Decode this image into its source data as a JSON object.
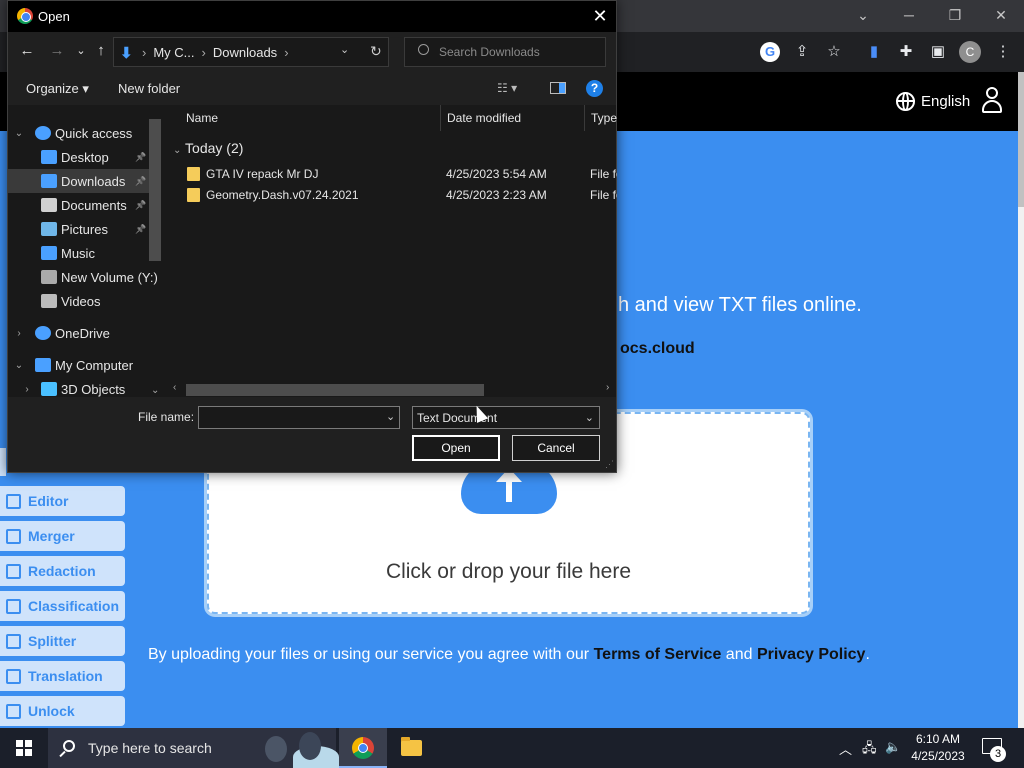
{
  "browser": {
    "window_controls": {
      "minimize": "─",
      "restore": "❐",
      "close": "✕",
      "tabs_menu": "⌄"
    },
    "toolbar_icons": [
      "google-icon",
      "share-icon",
      "bookmark-star-icon",
      "extension-docs-icon",
      "extensions-puzzle-icon",
      "side-panel-icon",
      "profile-avatar",
      "kebab-menu-icon"
    ],
    "profile_initial": "C"
  },
  "website": {
    "language": "English",
    "hero_headline": "h and view TXT files online.",
    "hero_domain": "ocs.cloud",
    "drop_text": "Click or drop your file here",
    "consent": {
      "prefix": "By uploading your files or using our service you agree with our ",
      "terms": "Terms of Service",
      "and": " and ",
      "privacy": "Privacy Policy",
      "suffix": "."
    },
    "tools": [
      "Editor",
      "Merger",
      "Redaction",
      "Classification",
      "Splitter",
      "Translation",
      "Unlock"
    ]
  },
  "dialog": {
    "title": "Open",
    "close_glyph": "✕",
    "nav": {
      "back": "←",
      "forward": "→",
      "recent": "⌄",
      "up": "↑"
    },
    "breadcrumbs": [
      "My C...",
      "Downloads"
    ],
    "breadcrumb_sep": "›",
    "search_placeholder": "Search Downloads",
    "organize_label": "Organize ▾",
    "new_folder_label": "New folder",
    "help_glyph": "?",
    "nav_pane": [
      {
        "label": "Quick access",
        "icon": "star-icon",
        "color": "#4aa0ff",
        "pinned": false,
        "expand": "⌄",
        "indent": 0
      },
      {
        "label": "Desktop",
        "icon": "desktop-icon",
        "color": "#4aa0ff",
        "pinned": true,
        "indent": 1
      },
      {
        "label": "Downloads",
        "icon": "download-icon",
        "color": "#4aa0ff",
        "pinned": true,
        "indent": 1,
        "selected": true
      },
      {
        "label": "Documents",
        "icon": "documents-icon",
        "color": "#d0d0d0",
        "pinned": true,
        "indent": 1
      },
      {
        "label": "Pictures",
        "icon": "pictures-icon",
        "color": "#6fb6e8",
        "pinned": true,
        "indent": 1
      },
      {
        "label": "Music",
        "icon": "music-icon",
        "color": "#4aa0ff",
        "pinned": false,
        "indent": 1
      },
      {
        "label": "New Volume (Y:)",
        "icon": "drive-icon",
        "color": "#aaaaaa",
        "pinned": false,
        "indent": 1
      },
      {
        "label": "Videos",
        "icon": "videos-icon",
        "color": "#bbbbbb",
        "pinned": false,
        "indent": 1
      },
      {
        "label": "OneDrive",
        "icon": "onedrive-icon",
        "color": "#4aa0ff",
        "pinned": false,
        "expand": "›",
        "indent": 0
      },
      {
        "label": "My Computer",
        "icon": "computer-icon",
        "color": "#4aa0ff",
        "pinned": false,
        "expand": "⌄",
        "indent": 0
      },
      {
        "label": "3D Objects",
        "icon": "3d-objects-icon",
        "color": "#4ac0ff",
        "pinned": false,
        "expand": "›",
        "indent": 1
      }
    ],
    "columns": {
      "name": "Name",
      "date": "Date modified",
      "type": "Type"
    },
    "group_label": "Today (2)",
    "files": [
      {
        "name": "GTA IV repack Mr DJ",
        "date": "4/25/2023 5:54 AM",
        "type": "File folder"
      },
      {
        "name": "Geometry.Dash.v07.24.2021",
        "date": "4/25/2023 2:23 AM",
        "type": "File folder"
      }
    ],
    "file_name_label": "File name:",
    "file_name_value": "",
    "file_type": "Text Document",
    "open_label": "Open",
    "cancel_label": "Cancel"
  },
  "taskbar": {
    "search_placeholder": "Type here to search",
    "time": "6:10 AM",
    "date": "4/25/2023",
    "notification_count": "3",
    "tray_icons": [
      "chevron-up-icon",
      "network-icon",
      "volume-icon"
    ]
  }
}
